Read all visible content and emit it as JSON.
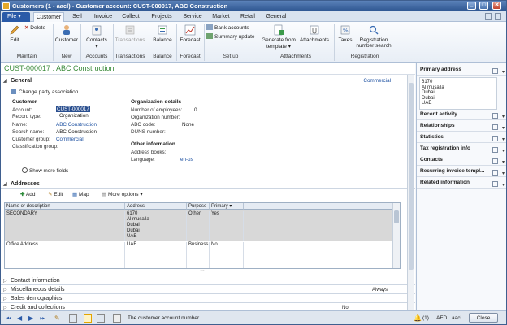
{
  "window": {
    "title": "Customers (1 - aacl) - Customer account: CUST-000017, ABC Construction"
  },
  "tabs": {
    "file": "File",
    "items": [
      "Customer",
      "Sell",
      "Invoice",
      "Collect",
      "Projects",
      "Service",
      "Market",
      "Retail",
      "General"
    ]
  },
  "ribbon": {
    "edit": "Edit",
    "delete": "Delete",
    "customer": "Customer",
    "contacts": "Contacts",
    "transactions": "Transactions",
    "balance": "Balance",
    "forecast": "Forecast",
    "bank_accounts": "Bank accounts",
    "summary_update": "Summary update",
    "generate": "Generate from",
    "template": "template",
    "attachments": "Attachments",
    "taxes": "Taxes",
    "registration": "Registration",
    "number_search": "number search",
    "groups": {
      "maintain": "Maintain",
      "new": "New",
      "accounts": "Accounts",
      "transactions": "Transactions",
      "balance": "Balance",
      "forecast": "Forecast",
      "setup": "Set up",
      "attachments": "Atttachments",
      "registration": "Registration"
    }
  },
  "page": {
    "title": "CUST-000017 : ABC Construction"
  },
  "general": {
    "title": "General",
    "commercial": "Commercial",
    "change_party": "Change party association",
    "customer_section": "Customer",
    "account_label": "Account:",
    "account_value": "CUST-000017",
    "record_type_label": "Record type:",
    "record_type_value": "Organization",
    "name_label": "Name:",
    "name_value": "ABC Construction",
    "search_name_label": "Search name:",
    "search_name_value": "ABC Construction",
    "customer_group_label": "Customer group:",
    "customer_group_value": "Commercial",
    "classification_label": "Classification group:",
    "org_section": "Organization details",
    "employees_label": "Number of employees:",
    "employees_value": "0",
    "org_number_label": "Organization number:",
    "abc_label": "ABC code:",
    "abc_value": "None",
    "duns_label": "DUNS number:",
    "other_section": "Other information",
    "address_books_label": "Address books:",
    "language_label": "Language:",
    "language_value": "en-us",
    "show_more": "Show more fields"
  },
  "addresses": {
    "title": "Addresses",
    "add": "Add",
    "edit": "Edit",
    "map": "Map",
    "more": "More options",
    "columns": [
      "Name or description",
      "Address",
      "Purpose",
      "Primary"
    ],
    "rows": [
      {
        "name": "SECONDARY",
        "address": [
          "6170",
          "Al musalla",
          "Dubai",
          "Dubai",
          "UAE"
        ],
        "purpose": "Other",
        "primary": "Yes"
      },
      {
        "name": "Office Address",
        "address": [
          "UAE"
        ],
        "purpose": "Business",
        "primary": "No"
      }
    ]
  },
  "collapsed_sections": [
    "Contact information",
    "Miscellaneous details",
    "Sales demographics",
    "Credit and collections"
  ],
  "collapsed_values": {
    "always": "Always",
    "no": "No"
  },
  "summary_pane": {
    "primary_address": "Primary address",
    "address_lines": [
      "6170",
      "Al musalla",
      "Dubai",
      "Dubai",
      "UAE"
    ],
    "items": [
      "Recent activity",
      "Relationships",
      "Statistics",
      "Tax registration info",
      "Contacts",
      "Recurring invoice templ...",
      "Related information"
    ]
  },
  "statusbar": {
    "message": "The customer account number",
    "count": "(1)",
    "currency": "AED",
    "company": "aacl",
    "close": "Close"
  }
}
